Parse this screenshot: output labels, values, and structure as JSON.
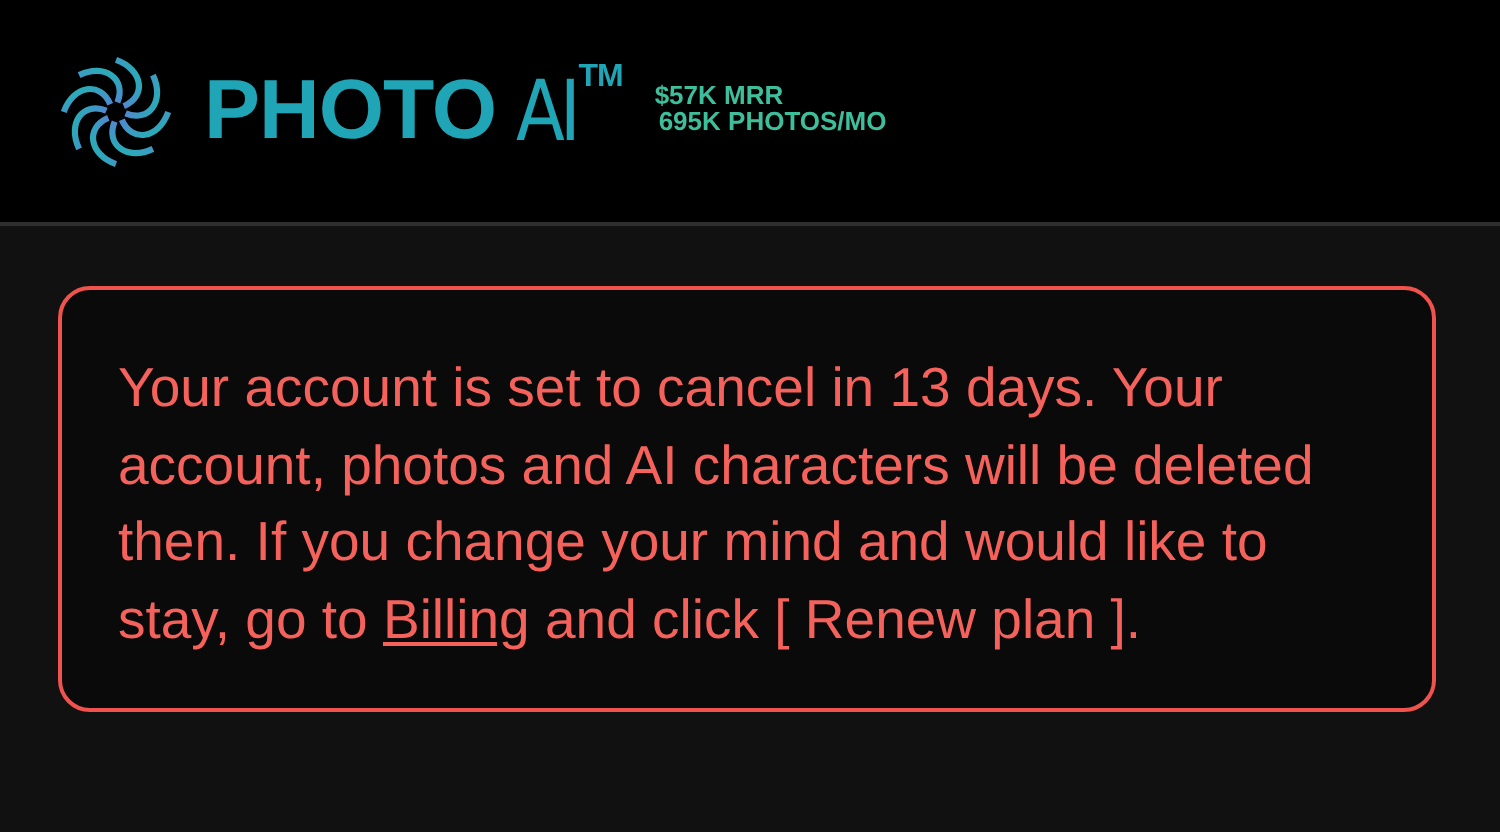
{
  "header": {
    "logo": {
      "words": [
        "PHOTO",
        "AI"
      ],
      "mark": "TM"
    },
    "stats": [
      "$57K MRR",
      "695K PHOTOS/MO"
    ]
  },
  "alert": {
    "before": "Your account is set to cancel in 13 days. Your account, photos and AI characters will be deleted then. If you change your mind and would like to stay, go to ",
    "link": "Billing",
    "after": " and click [ Renew plan ]."
  }
}
